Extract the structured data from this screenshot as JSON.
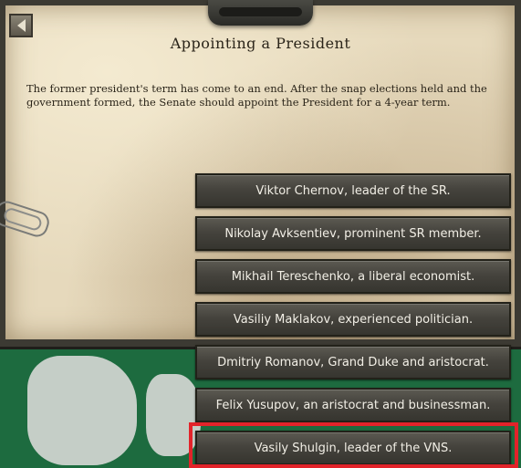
{
  "event": {
    "title": "Appointing a President",
    "description": "The former president's term has come to an end. After the snap elections held and the government formed, the Senate should appoint the President for a 4-year term.",
    "options": [
      {
        "label": "Viktor Chernov, leader of the SR."
      },
      {
        "label": "Nikolay Avksentiev, prominent SR member."
      },
      {
        "label": "Mikhail Tereschenko, a liberal economist."
      },
      {
        "label": "Vasiliy Maklakov, experienced politician."
      },
      {
        "label": "Dmitriy Romanov, Grand Duke and aristocrat."
      },
      {
        "label": "Felix Yusupov, an aristocrat and businessman."
      },
      {
        "label": "Vasily Shulgin, leader of the VNS."
      }
    ]
  },
  "icons": {
    "back": "back-arrow-icon",
    "clip": "paperclip-icon"
  },
  "colors": {
    "highlight": "#e2232a",
    "parchment": "#e6d9bc",
    "button": "#45433d",
    "map_green": "#1d6b3f"
  }
}
